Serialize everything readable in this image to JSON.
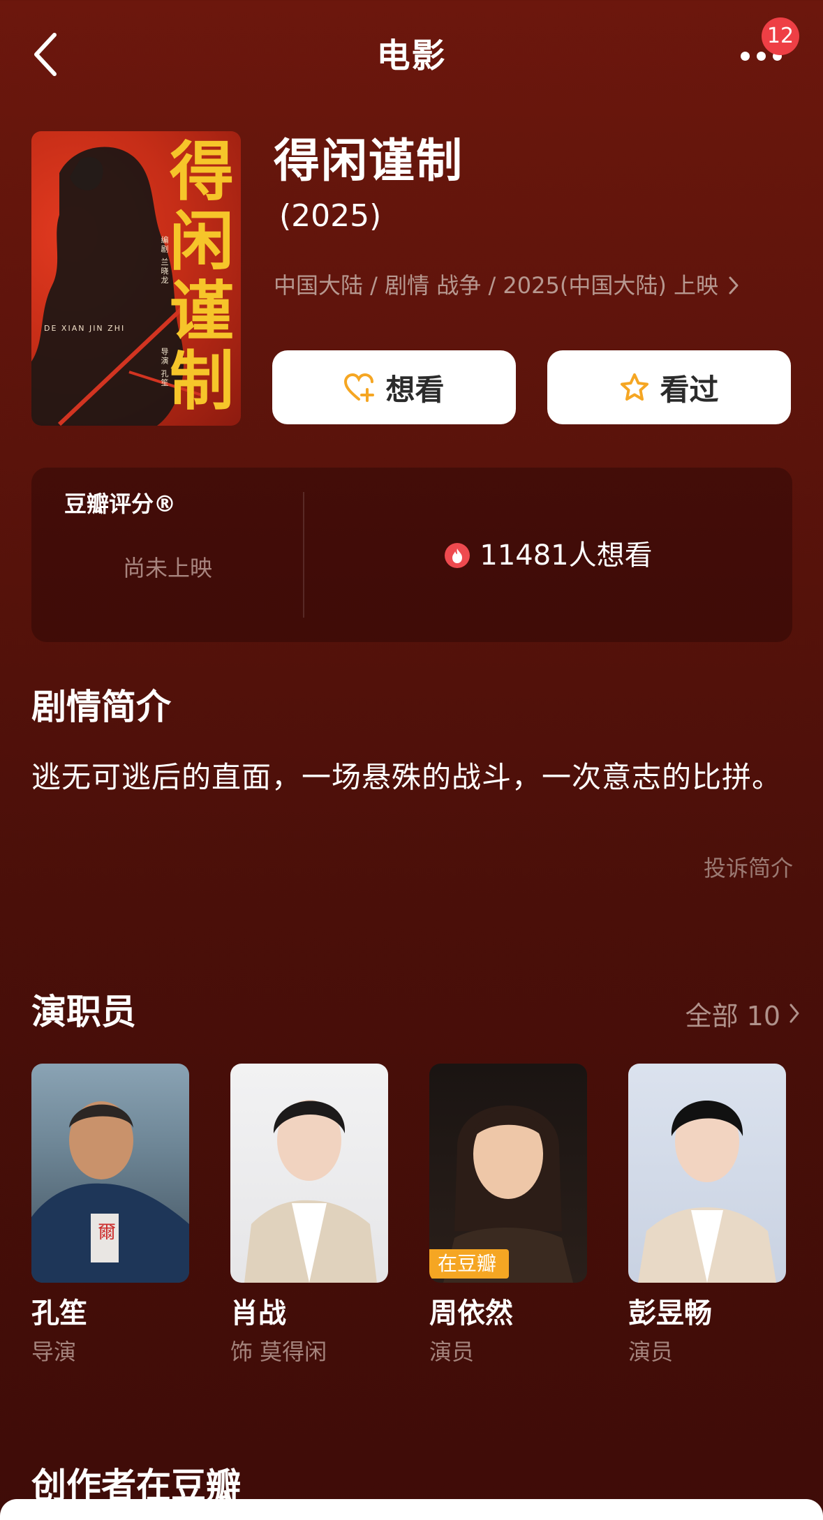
{
  "header": {
    "title": "电影",
    "badge_count": "12",
    "back_icon": "chevron-left-icon",
    "more_icon": "more-dots-icon"
  },
  "movie": {
    "title": "得闲谨制",
    "year": "(2025)",
    "meta": "中国大陆 / 剧情 战争 / 2025(中国大陆) 上映",
    "poster": {
      "title_chars": [
        "得",
        "闲",
        "谨",
        "制"
      ],
      "subtext": "DE XIAN JIN ZHI",
      "credit_1": "编剧 兰晓龙",
      "credit_2": "导演 孔笙"
    }
  },
  "actions": {
    "want_label": "想看",
    "seen_label": "看过"
  },
  "rating": {
    "label": "豆瓣评分®",
    "status": "尚未上映",
    "wish_count": "11481人想看"
  },
  "synopsis": {
    "title": "剧情简介",
    "text": "逃无可逃后的直面，一场悬殊的战斗，一次意志的比拼。",
    "report": "投诉简介"
  },
  "cast": {
    "title": "演职员",
    "all_label": "全部 10",
    "members": [
      {
        "name": "孔笙",
        "role": "导演",
        "badge": ""
      },
      {
        "name": "肖战",
        "role": "饰 莫得闲",
        "badge": ""
      },
      {
        "name": "周依然",
        "role": "演员",
        "badge": "在豆瓣"
      },
      {
        "name": "彭昱畅",
        "role": "演员",
        "badge": ""
      }
    ]
  },
  "creators": {
    "title": "创作者在豆瓣"
  },
  "colors": {
    "background_top": "#6c170d",
    "background_bottom": "#3f0c08",
    "accent_gold": "#f6c52a",
    "badge_red": "#ee3f45",
    "button_icon": "#f5a623",
    "tag_orange": "#f5a623"
  }
}
